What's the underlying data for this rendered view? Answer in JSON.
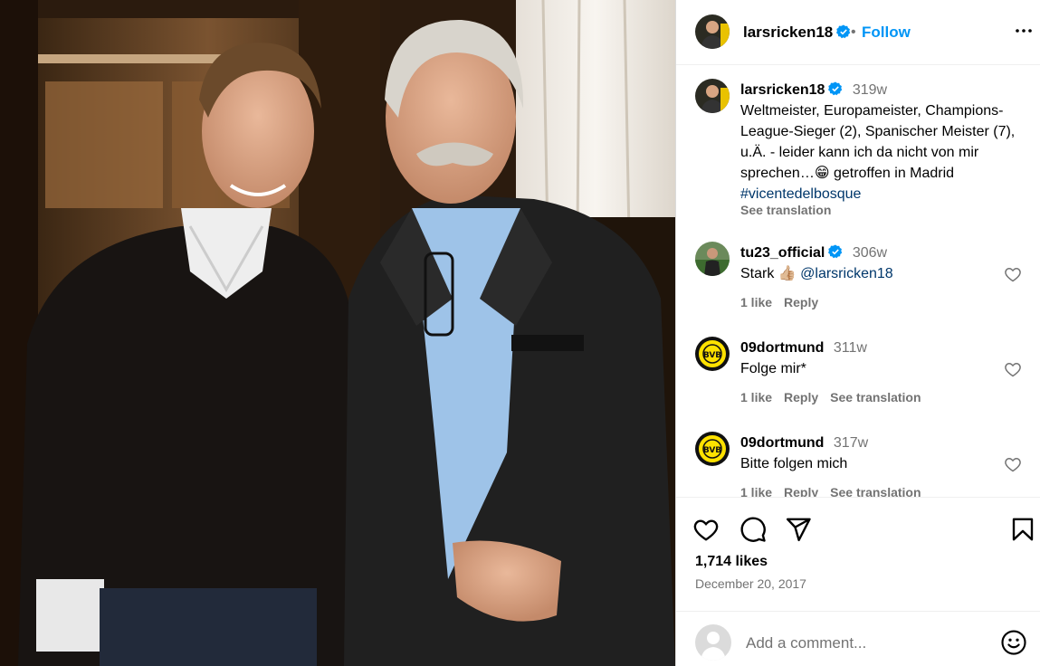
{
  "post": {
    "username": "larsricken18",
    "follow_label": "Follow",
    "separator": "•",
    "caption": {
      "username": "larsricken18",
      "time": "319w",
      "text": "Weltmeister, Europameister, Champions-League-Sieger (2), Spanischer Meister (7), u.Ä. - leider kann ich da nicht von mir sprechen…😁 getroffen in Madrid ",
      "hashtag": "#vicentedelbosque",
      "see_translation": "See translation"
    },
    "comments": [
      {
        "username": "tu23_official",
        "verified": true,
        "time": "306w",
        "text": "Stark 👍🏼 ",
        "mention": "@larsricken18",
        "likes": "1 like",
        "reply": "Reply",
        "see_translation": ""
      },
      {
        "username": "09dortmund",
        "verified": false,
        "time": "311w",
        "text": "Folge mir*",
        "mention": "",
        "likes": "1 like",
        "reply": "Reply",
        "see_translation": "See translation"
      },
      {
        "username": "09dortmund",
        "verified": false,
        "time": "317w",
        "text": "Bitte folgen mich",
        "mention": "",
        "likes": "1 like",
        "reply": "Reply",
        "see_translation": "See translation"
      }
    ],
    "likes_count": "1,714 likes",
    "date": "December 20, 2017",
    "add_comment_placeholder": "Add a comment...",
    "icons": {
      "like": "heart-icon",
      "comment": "comment-icon",
      "share": "share-icon",
      "save": "bookmark-icon",
      "more": "more-icon",
      "verified": "verified-badge-icon",
      "emoji": "emoji-icon"
    },
    "colors": {
      "follow": "#0095f6",
      "verified": "#0095f6",
      "hashtag": "#00376b",
      "secondary": "#737373"
    }
  }
}
